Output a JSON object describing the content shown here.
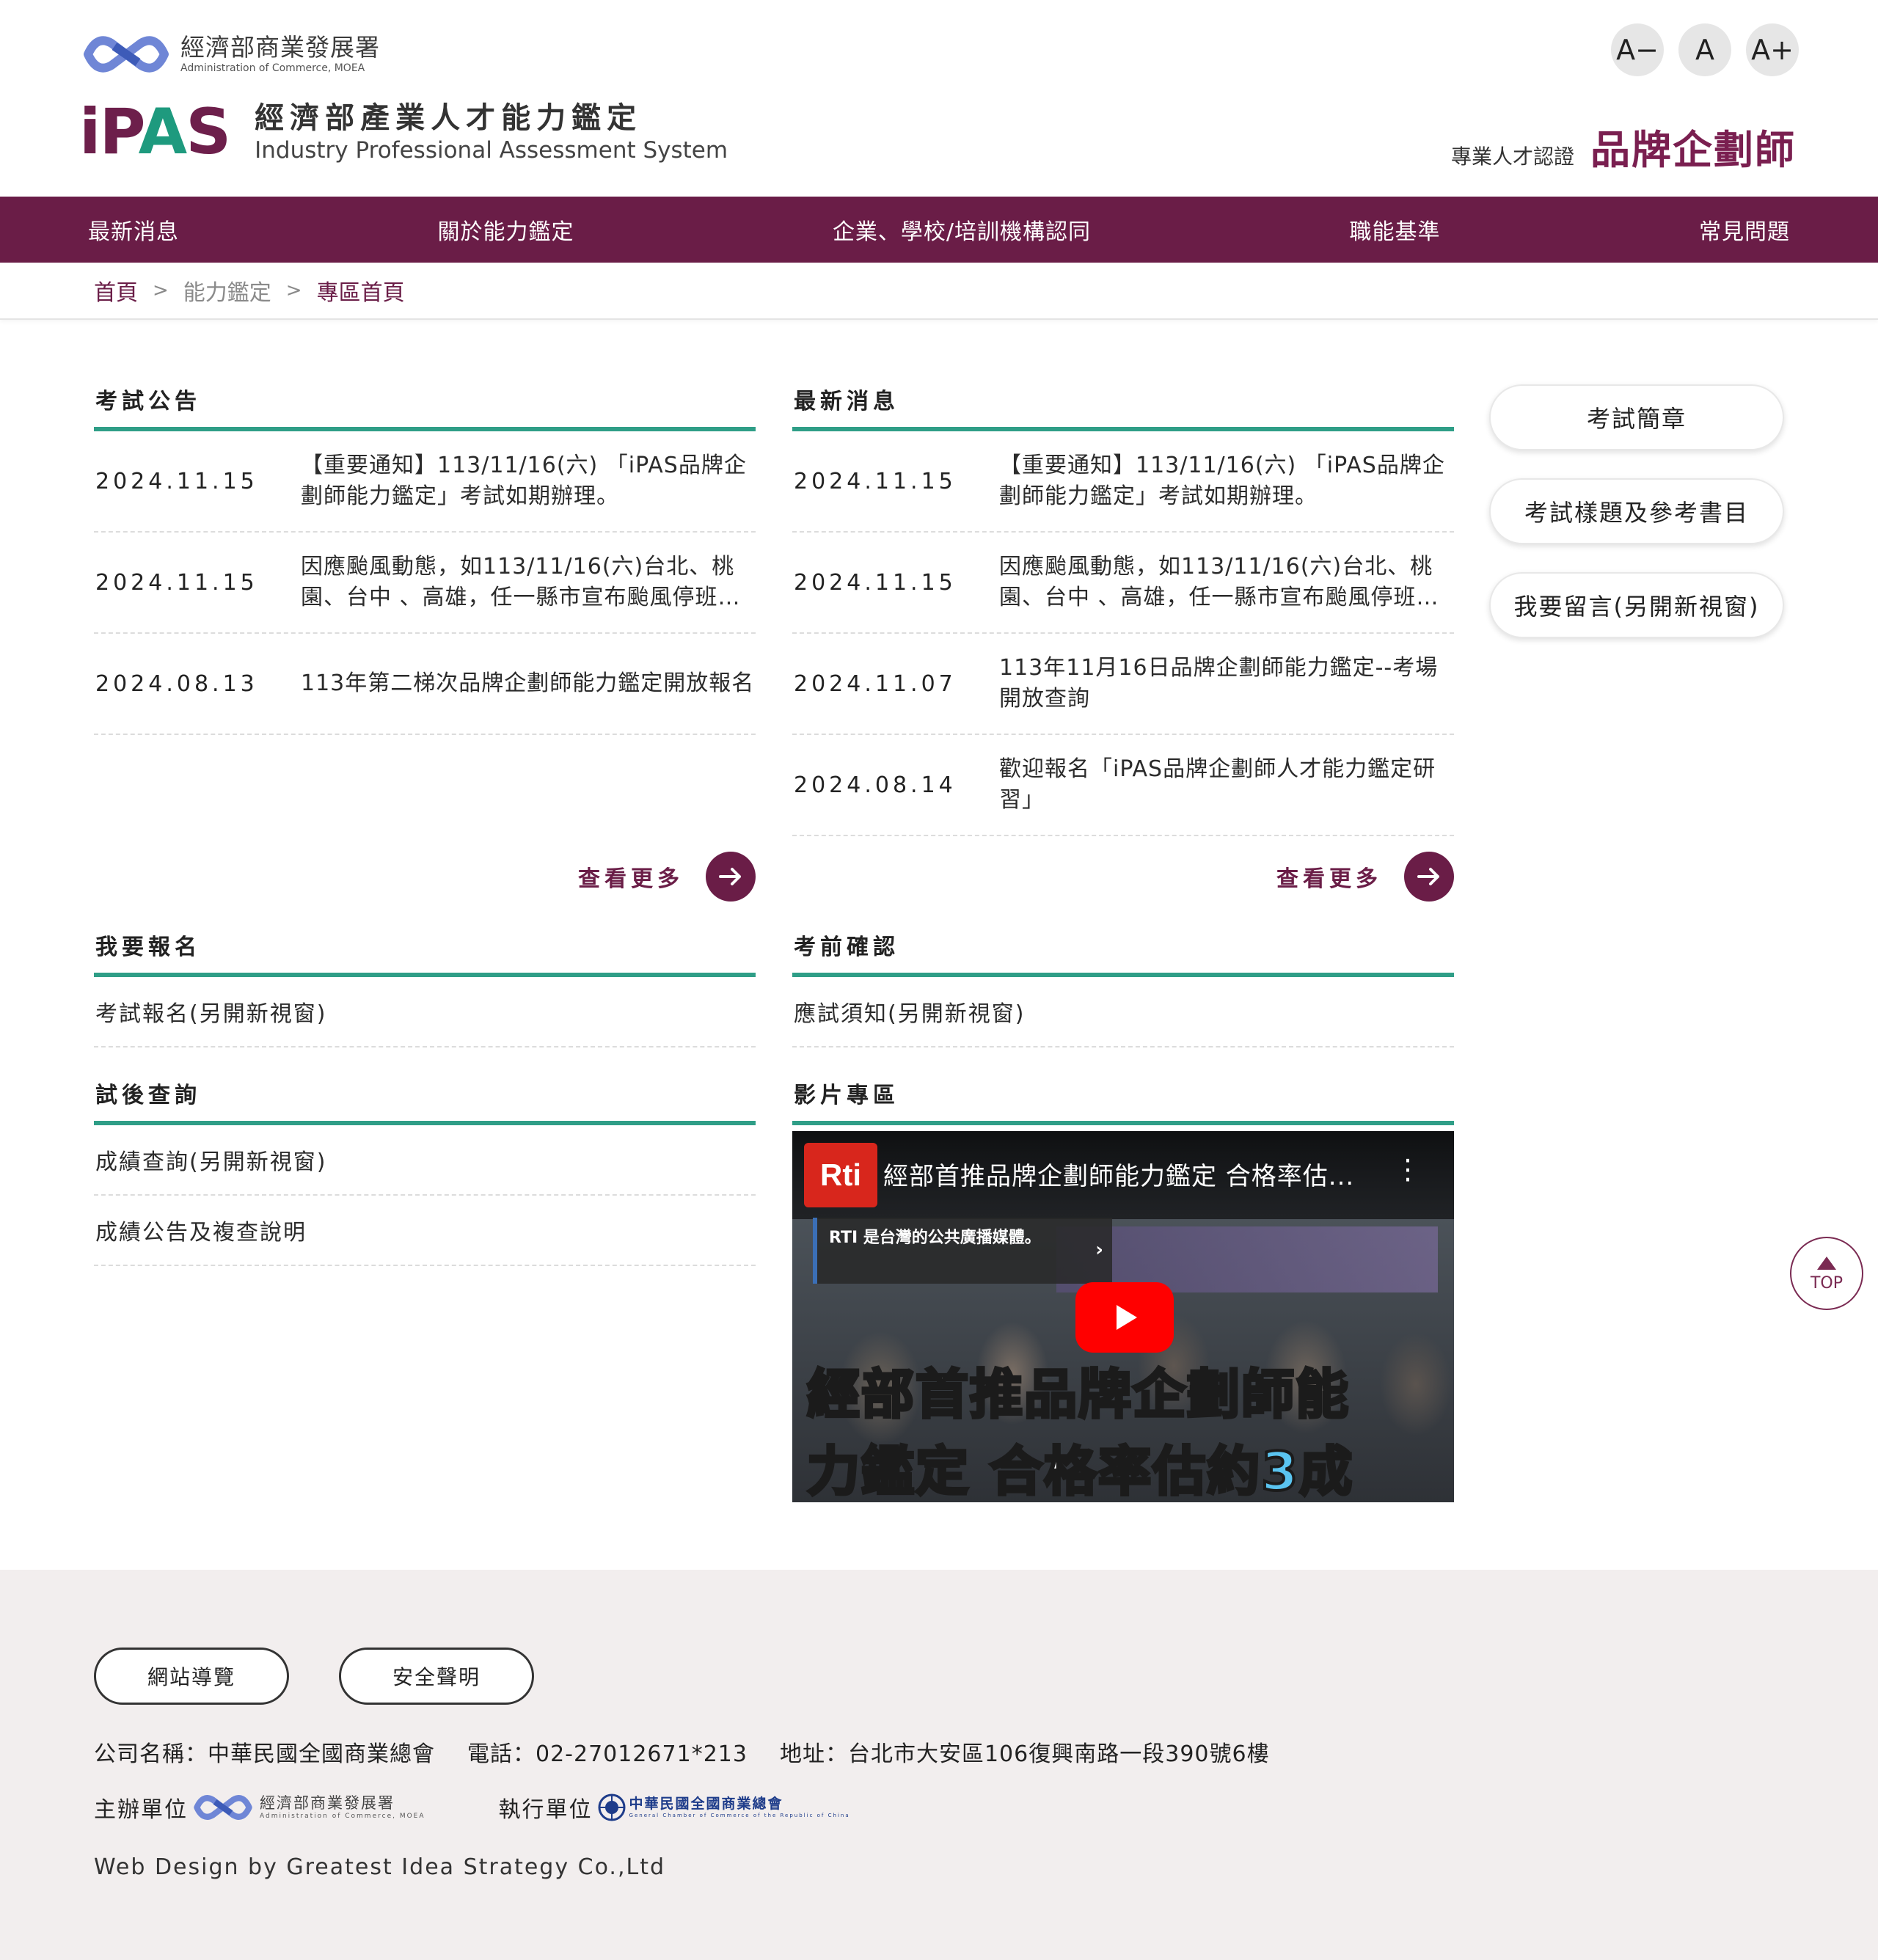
{
  "header": {
    "moea_name_zh": "經濟部商業發展署",
    "moea_name_en": "Administration of Commerce, MOEA",
    "ipas_wordmark_start": "iP",
    "ipas_wordmark_a": "A",
    "ipas_wordmark_end": "S",
    "ipas_name_zh": "經濟部產業人才能力鑑定",
    "ipas_name_en": "Industry Professional Assessment System",
    "font_sizes": [
      "A−",
      "A",
      "A+"
    ],
    "cert_label": "專業人才認證",
    "cert_title": "品牌企劃師"
  },
  "nav": {
    "items": [
      "最新消息",
      "關於能力鑑定",
      "企業、學校/培訓機構認同",
      "職能基準",
      "常見問題"
    ]
  },
  "breadcrumb": {
    "home": "首頁",
    "middle": "能力鑑定",
    "current": "專區首頁",
    "separator": ">"
  },
  "exam_notice": {
    "title": "考試公告",
    "items": [
      {
        "date": "2024.11.15",
        "title": "【重要通知】113/11/16(六) 「iPAS品牌企劃師能力鑑定」考試如期辦理。"
      },
      {
        "date": "2024.11.15",
        "title": "因應颱風動態，如113/11/16(六)台北、桃園、台中 、高雄，任一縣市宣布颱風停班停課，考試延期辦理。"
      },
      {
        "date": "2024.08.13",
        "title": "113年第二梯次品牌企劃師能力鑑定開放報名"
      }
    ],
    "more_label": "查看更多"
  },
  "latest_news": {
    "title": "最新消息",
    "items": [
      {
        "date": "2024.11.15",
        "title": "【重要通知】113/11/16(六) 「iPAS品牌企劃師能力鑑定」考試如期辦理。"
      },
      {
        "date": "2024.11.15",
        "title": "因應颱風動態，如113/11/16(六)台北、桃園、台中 、高雄，任一縣市宣布颱風停班停課，考試延期辦理。"
      },
      {
        "date": "2024.11.07",
        "title": "113年11月16日品牌企劃師能力鑑定--考場開放查詢"
      },
      {
        "date": "2024.08.14",
        "title": "歡迎報名「iPAS品牌企劃師人才能力鑑定研習」"
      }
    ],
    "more_label": "查看更多"
  },
  "register": {
    "title": "我要報名",
    "links": [
      "考試報名(另開新視窗)"
    ]
  },
  "pre_exam": {
    "title": "考前確認",
    "links": [
      "應試須知(另開新視窗)"
    ]
  },
  "post_exam": {
    "title": "試後查詢",
    "links": [
      "成績查詢(另開新視窗)",
      "成績公告及複查說明"
    ]
  },
  "video_section": {
    "title": "影片專區",
    "channel_logo": "Rti",
    "video_title": "經部首推品牌企劃師能力鑑定 合格率估...",
    "info_card": "RTI 是台灣的公共廣播媒體。",
    "caption_line1_a": "經部首推",
    "caption_line1_b": "品牌企劃師能",
    "caption_line2_a": "力鑑定 合格率估約",
    "caption_line2_b": "3成"
  },
  "side_buttons": [
    "考試簡章",
    "考試樣題及參考書目",
    "我要留言(另開新視窗)"
  ],
  "top_button": {
    "label": "TOP"
  },
  "footer": {
    "buttons": [
      "網站導覽",
      "安全聲明"
    ],
    "company": "公司名稱：中華民國全國商業總會",
    "phone": "電話：02-27012671*213",
    "address": "地址：台北市大安區106復興南路一段390號6樓",
    "organizer_label": "主辦單位",
    "organizer_zh": "經濟部商業發展署",
    "organizer_en": "Administration of Commerce, MOEA",
    "executor_label": "執行單位",
    "executor_zh": "中華民國全國商業總會",
    "executor_en": "General Chamber of Commerce of the Republic of China",
    "credit": "Web Design by  Greatest Idea Strategy Co.,Ltd"
  },
  "colors": {
    "brand_maroon": "#6a1d47",
    "accent_green": "#2f9e87",
    "footer_bg": "#f2eeee"
  }
}
